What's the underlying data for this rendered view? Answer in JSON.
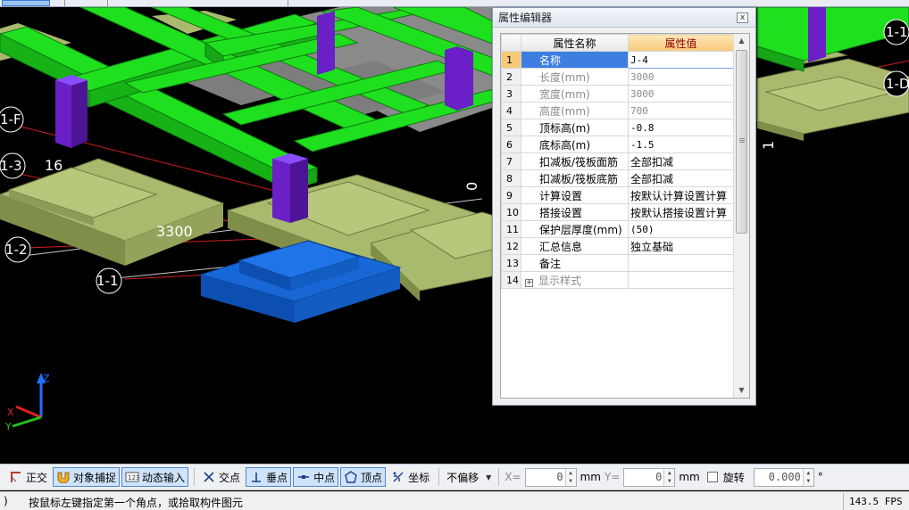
{
  "panel": {
    "title": "属性编辑器",
    "close_glyph": "x",
    "col_name_header": "属性名称",
    "col_value_header": "属性值",
    "rows": [
      {
        "num": "1",
        "name": "名称",
        "value": "J-4"
      },
      {
        "num": "2",
        "name": "长度(mm)",
        "value": "3000"
      },
      {
        "num": "3",
        "name": "宽度(mm)",
        "value": "3000"
      },
      {
        "num": "4",
        "name": "高度(mm)",
        "value": "700"
      },
      {
        "num": "5",
        "name": "顶标高(m)",
        "value": "-0.8"
      },
      {
        "num": "6",
        "name": "底标高(m)",
        "value": "-1.5"
      },
      {
        "num": "7",
        "name": "扣减板/筏板面筋",
        "value": "全部扣减"
      },
      {
        "num": "8",
        "name": "扣减板/筏板底筋",
        "value": "全部扣减"
      },
      {
        "num": "9",
        "name": "计算设置",
        "value": "按默认计算设置计算"
      },
      {
        "num": "10",
        "name": "搭接设置",
        "value": "按默认搭接设置计算"
      },
      {
        "num": "11",
        "name": "保护层厚度(mm)",
        "value": "(50)"
      },
      {
        "num": "12",
        "name": "汇总信息",
        "value": "独立基础"
      },
      {
        "num": "13",
        "name": "备注",
        "value": ""
      },
      {
        "num": "14",
        "name": "显示样式",
        "value": "",
        "expand": "+"
      }
    ]
  },
  "viewport": {
    "axis_labels": [
      "1-F",
      "1-3",
      "1-2",
      "1-1",
      "1-1",
      "1-D"
    ],
    "dim_labels": [
      "3300",
      "16",
      "0",
      "1"
    ],
    "coord_axes": {
      "z": "Z",
      "x": "X",
      "y": "Y"
    },
    "colors": {
      "beam": "#1ee01e",
      "column": "#6a1fc7",
      "footing": "#a9ba6f",
      "selected": "#1767d6",
      "grid_line": "#e02020",
      "arrow": "#27c6d6"
    }
  },
  "toolbar": {
    "ortho": "正交",
    "snap": "对象捕捉",
    "dynamic_input": "动态输入",
    "intersection": "交点",
    "perpendicular": "垂点",
    "midpoint": "中点",
    "vertex": "顶点",
    "coord": "坐标",
    "offset_mode": "不偏移",
    "x_label": "X=",
    "x_value": "0",
    "x_unit": "mm",
    "y_label": "Y=",
    "y_value": "0",
    "y_unit": "mm",
    "rotate": "旋转",
    "rotate_value": "0.000",
    "degree": "°"
  },
  "status": {
    "prefix": ")",
    "message": "按鼠标左键指定第一个角点，或拾取构件图元",
    "fps": "143.5 FPS"
  }
}
